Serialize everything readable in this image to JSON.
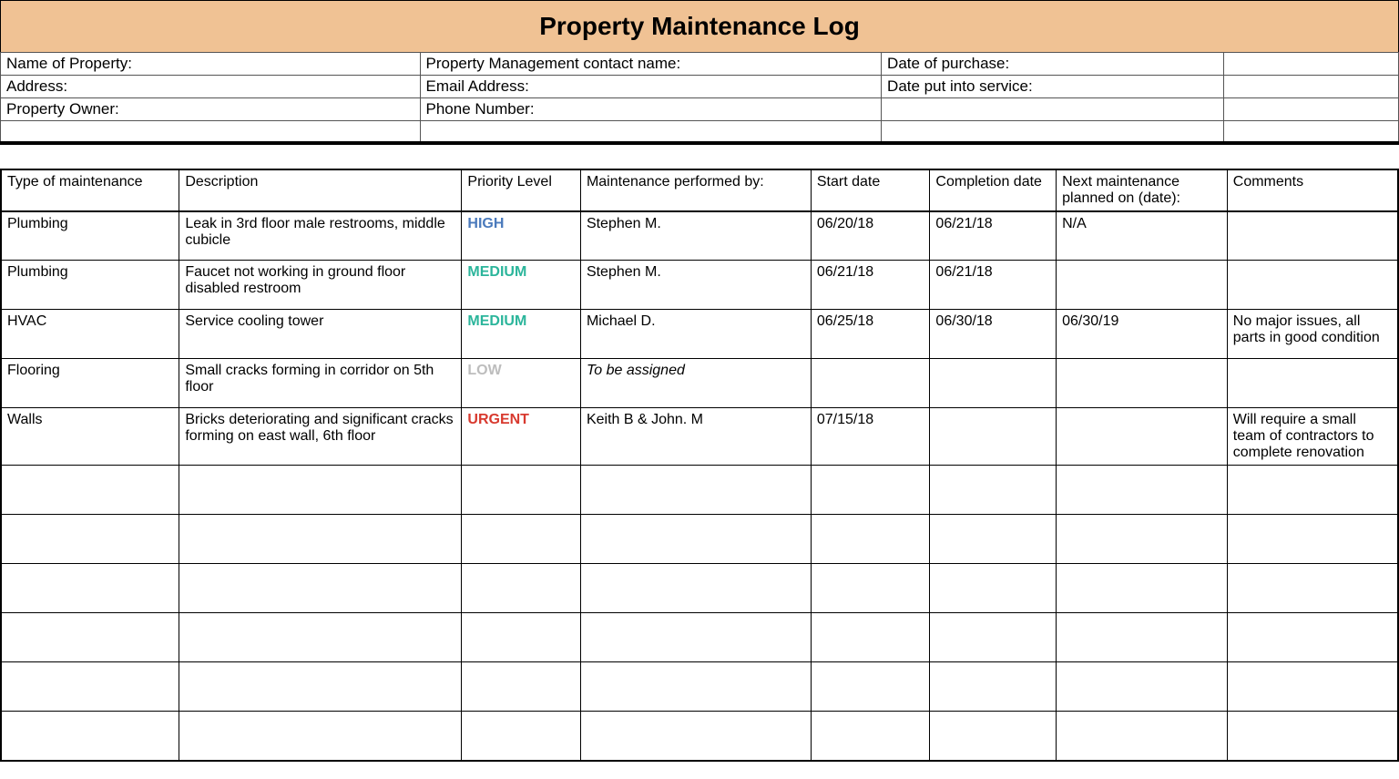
{
  "title": "Property Maintenance Log",
  "info": {
    "name_of_property": "Name of Property:",
    "property_management_contact": "Property Management contact name:",
    "date_of_purchase": "Date of purchase:",
    "address": "Address:",
    "email_address": "Email Address:",
    "date_put_into_service": "Date put into service:",
    "property_owner": "Property Owner:",
    "phone_number": "Phone Number:"
  },
  "columns": {
    "type": "Type of maintenance",
    "description": "Description",
    "priority": "Priority Level",
    "performed_by": "Maintenance performed by:",
    "start_date": "Start date",
    "completion_date": "Completion date",
    "next_maintenance": "Next maintenance planned on (date):",
    "comments": "Comments"
  },
  "rows": [
    {
      "type": "Plumbing",
      "description": "Leak in 3rd floor male restrooms, middle cubicle",
      "priority": "HIGH",
      "priority_class": "p-high",
      "performed_by": "Stephen M.",
      "start_date": "06/20/18",
      "completion_date": "06/21/18",
      "next_maintenance": "N/A",
      "comments": "",
      "italic": false
    },
    {
      "type": "Plumbing",
      "description": "Faucet not working in ground floor disabled restroom",
      "priority": "MEDIUM",
      "priority_class": "p-medium",
      "performed_by": "Stephen M.",
      "start_date": "06/21/18",
      "completion_date": "06/21/18",
      "next_maintenance": "",
      "comments": "",
      "italic": false
    },
    {
      "type": "HVAC",
      "description": "Service cooling tower",
      "priority": "MEDIUM",
      "priority_class": "p-medium",
      "performed_by": "Michael D.",
      "start_date": "06/25/18",
      "completion_date": "06/30/18",
      "next_maintenance": "06/30/19",
      "comments": "No major issues, all parts in good condition",
      "italic": false
    },
    {
      "type": "Flooring",
      "description": "Small cracks forming in corridor on 5th floor",
      "priority": "LOW",
      "priority_class": "p-low",
      "performed_by": "To be assigned",
      "start_date": "",
      "completion_date": "",
      "next_maintenance": "",
      "comments": "",
      "italic": true
    },
    {
      "type": "Walls",
      "description": "Bricks deteriorating and significant cracks forming on east wall, 6th floor",
      "priority": "URGENT",
      "priority_class": "p-urgent",
      "performed_by": "Keith B & John. M",
      "start_date": "07/15/18",
      "completion_date": "",
      "next_maintenance": "",
      "comments": "Will require a small team of contractors to complete renovation",
      "italic": false
    }
  ],
  "empty_rows": 6
}
